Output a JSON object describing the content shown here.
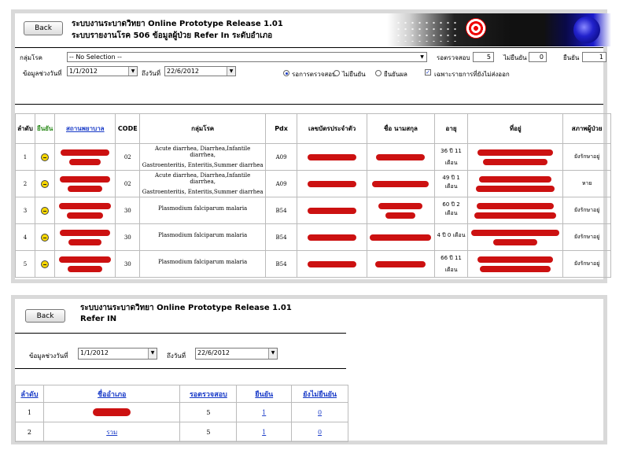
{
  "panel_top": {
    "back_label": "Back",
    "title_line1": "ระบบงานระบาดวิทยา Online Prototype Release 1.01",
    "title_line2": "ระบบรายงานโรค 506 ข้อมูลผู้ป่วย Refer In ระดับอำเภอ",
    "filters": {
      "disease_label": "กลุ่มโรค",
      "disease_value": "-- No Selection --",
      "pending_label": "รอตรวจสอบ",
      "pending_value": "5",
      "unconfirmed_label": "ไม่ยืนยัน",
      "unconfirmed_value": "0",
      "confirmed_label": "ยืนยัน",
      "confirmed_value": "1",
      "date_range_label": "ข้อมูลช่วงวันที่",
      "date_from": "1/1/2012",
      "to_label": "ถึงวันที่",
      "date_to": "22/6/2012",
      "radio_options": [
        "รอการตรวจสอบ",
        "ไม่ยืนยัน",
        "ยืนยันผล"
      ],
      "radio_selected": 0,
      "checkbox_label": "เฉพาะรายการที่ยังไม่ส่งออก",
      "checkbox_checked": true
    },
    "table": {
      "headers": {
        "no": "ลำดับ",
        "confirm": "ยืนยัน",
        "hospital": "สถานพยาบาล",
        "code": "CODE",
        "disease_group": "กลุ่มโรค",
        "pdx": "Pdx",
        "id_card": "เลขบัตรประจำตัว",
        "name": "ชื่อ นามสกุล",
        "age": "อายุ",
        "address": "ที่อยู่",
        "status": "สภาพผู้ป่วย"
      },
      "rows": [
        {
          "no": "1",
          "code": "02",
          "disease_line1": "Acute diarrhea, Diarrhea,Infantile diarrhea,",
          "disease_line2": "Gastroenteritis, Enteritis,Summer diarrhea",
          "pdx": "A09",
          "age_line1": "36 ปี 11",
          "age_line2": "เดือน",
          "status": "ยังรักษาอยู่"
        },
        {
          "no": "2",
          "code": "02",
          "disease_line1": "Acute diarrhea, Diarrhea,Infantile diarrhea,",
          "disease_line2": "Gastroenteritis, Enteritis,Summer diarrhea",
          "pdx": "A09",
          "age_line1": "49 ปี 1 เดือน",
          "age_line2": "",
          "status": "หาย"
        },
        {
          "no": "3",
          "code": "30",
          "disease_line1": "Plasmodium falciparum malaria",
          "disease_line2": "",
          "pdx": "B54",
          "age_line1": "60 ปี 2 เดือน",
          "age_line2": "",
          "status": "ยังรักษาอยู่"
        },
        {
          "no": "4",
          "code": "30",
          "disease_line1": "Plasmodium falciparum malaria",
          "disease_line2": "",
          "pdx": "B54",
          "age_line1": "4 ปี 0 เดือน",
          "age_line2": "",
          "status": "ยังรักษาอยู่"
        },
        {
          "no": "5",
          "code": "30",
          "disease_line1": "Plasmodium falciparum malaria",
          "disease_line2": "",
          "pdx": "B54",
          "age_line1": "66 ปี 11",
          "age_line2": "เดือน",
          "status": "ยังรักษาอยู่"
        }
      ]
    }
  },
  "panel_bottom": {
    "back_label": "Back",
    "title_line1": "ระบบงานระบาดวิทยา Online Prototype Release 1.01",
    "title_line2": "Refer IN",
    "date_range_label": "ข้อมูลช่วงวันที่",
    "date_from": "1/1/2012",
    "to_label": "ถึงวันที่",
    "date_to": "22/6/2012",
    "table": {
      "headers": {
        "no": "ลำดับ",
        "district": "ชื่ออำเภอ",
        "pending": "รอตรวจสอบ",
        "confirmed": "ยืนยัน",
        "unconfirmed": "ยังไม่ยืนยัน"
      },
      "rows": [
        {
          "no": "1",
          "district": "",
          "pending": "5",
          "confirmed": "1",
          "unconfirmed": "0"
        },
        {
          "no": "2",
          "district": "รวม",
          "pending": "5",
          "confirmed": "1",
          "unconfirmed": "0"
        }
      ]
    }
  },
  "colors": {
    "redaction": "#cc1111",
    "link": "#1a3cc8",
    "panel_border": "#d9d9d9"
  }
}
